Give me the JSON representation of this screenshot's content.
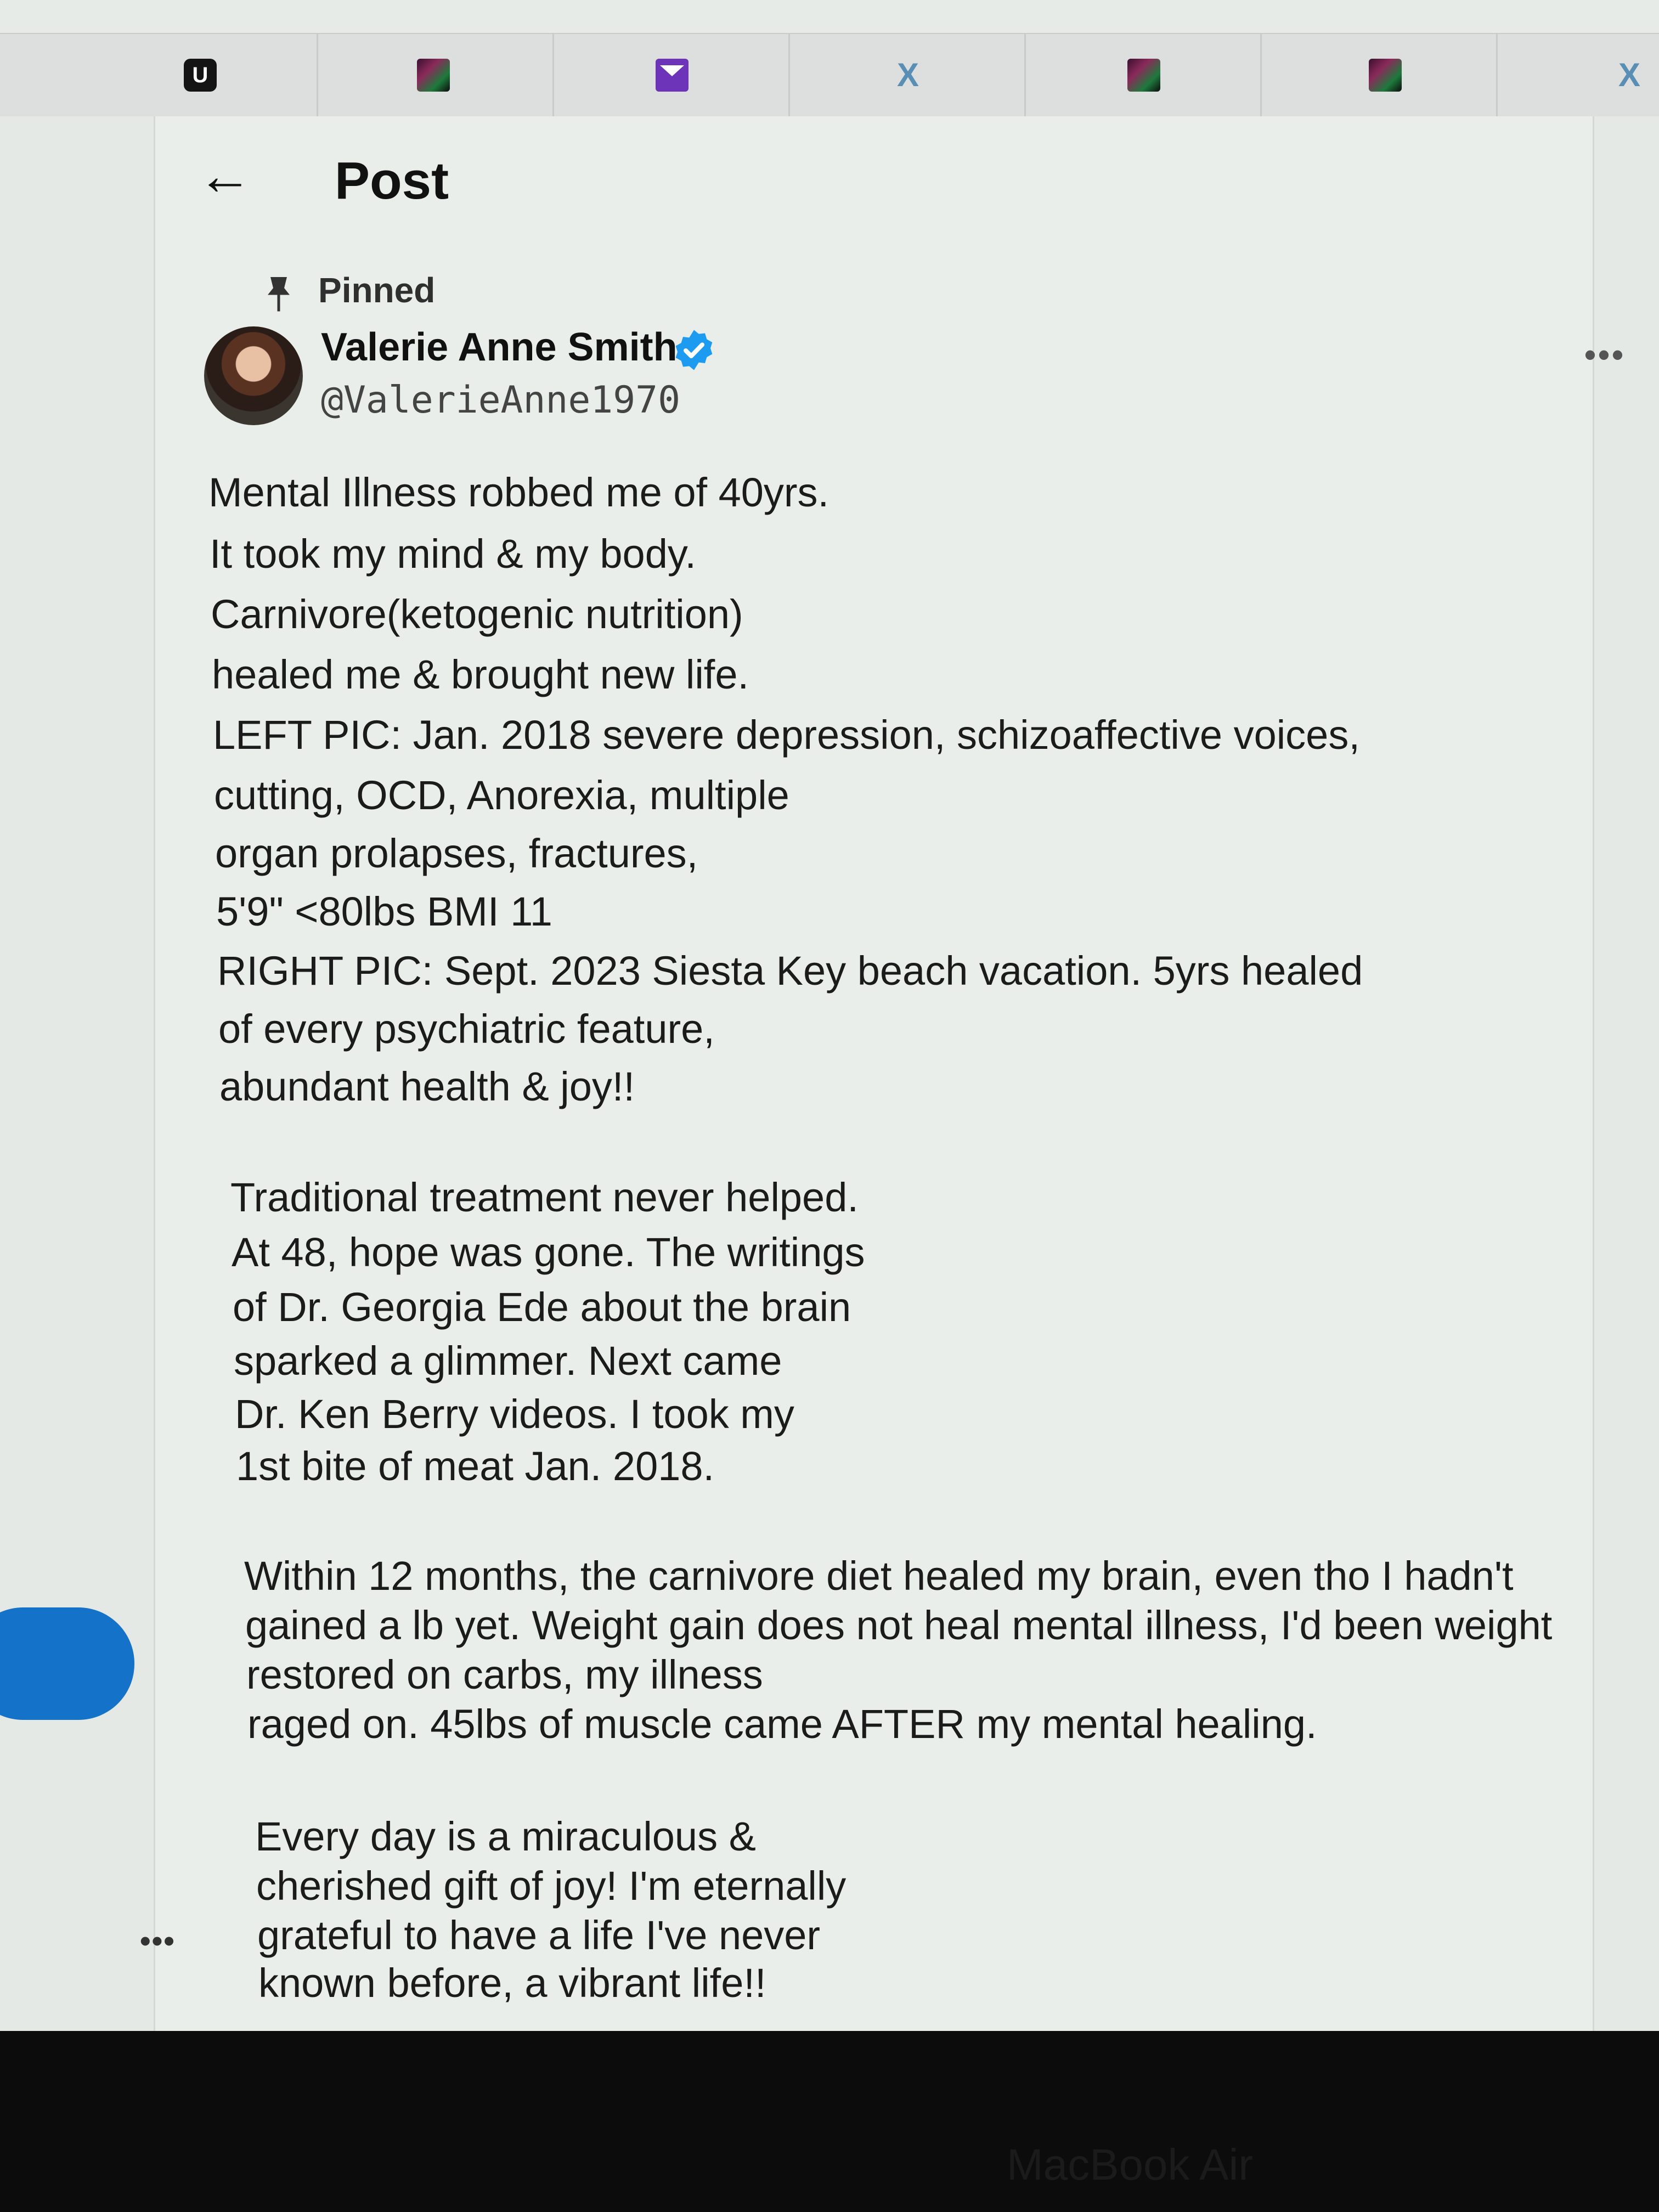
{
  "browser": {
    "tabs": [
      {
        "icon": "u-app-icon",
        "label": "U"
      },
      {
        "icon": "image-thumb-icon"
      },
      {
        "icon": "mail-icon"
      },
      {
        "icon": "x-logo-icon",
        "label": "X"
      },
      {
        "icon": "image-thumb-icon"
      },
      {
        "icon": "image-thumb-icon"
      },
      {
        "icon": "x-logo-icon",
        "label": "X"
      }
    ]
  },
  "header": {
    "title": "Post"
  },
  "post": {
    "pinned_label": "Pinned",
    "author_name": "Valerie Anne Smith",
    "author_handle": "@ValerieAnne1970",
    "verified": true,
    "lines": [
      "Mental Illness robbed me of 40yrs.",
      "It took my mind & my body.",
      "Carnivore(ketogenic nutrition)",
      "healed me & brought new life.",
      "LEFT PIC: Jan. 2018 severe depression, schizoaffective voices,",
      "cutting, OCD, Anorexia, multiple",
      "organ prolapses, fractures,",
      "5'9\" <80lbs BMI 11",
      "RIGHT PIC: Sept. 2023 Siesta Key beach vacation. 5yrs healed",
      "of every psychiatric feature,",
      "abundant health & joy!!",
      "Traditional treatment never helped.",
      "At 48, hope was gone. The writings",
      "of Dr. Georgia Ede about the brain",
      "sparked a glimmer. Next came",
      "Dr. Ken Berry videos. I took my",
      "1st bite of meat Jan. 2018.",
      "Within 12 months, the carnivore diet healed my brain, even tho I hadn't",
      "gained a lb yet. Weight gain does not heal mental illness, I'd been weight",
      "restored on carbs, my illness",
      "raged on. 45lbs of muscle came AFTER my mental healing.",
      "Every day is a miraculous &",
      "cherished gift of joy! I'm eternally",
      "grateful to have a life I've never",
      "known before, a vibrant life!!"
    ]
  },
  "device": {
    "bezel_label": "MacBook Air"
  },
  "colors": {
    "accent": "#1d9bf0",
    "blue_button": "#1473c9",
    "text": "#1b1b1b"
  }
}
